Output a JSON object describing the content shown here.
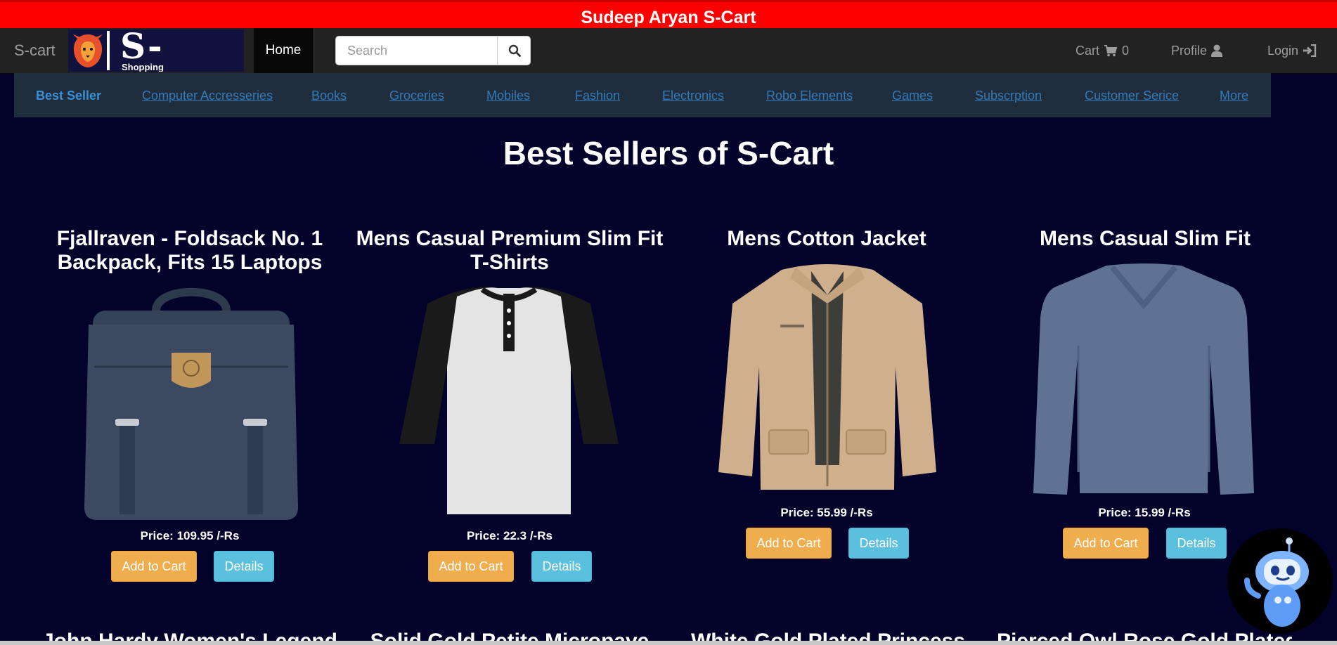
{
  "banner": {
    "title": "Sudeep Aryan S-Cart"
  },
  "navbar": {
    "brand": "S-cart",
    "logo_text": "S-cart",
    "logo_sub": "Shopping",
    "home": "Home",
    "search_placeholder": "Search",
    "cart_label": "Cart",
    "cart_count": "0",
    "profile_label": "Profile",
    "login_label": "Login"
  },
  "categories": [
    "Best Seller",
    "Computer Accresseries",
    "Books",
    "Groceries",
    "Mobiles",
    "Fashion",
    "Electronics",
    "Robo Elements",
    "Games",
    "Subscrption",
    "Customer Serice",
    "More"
  ],
  "page": {
    "heading": "Best Sellers of S-Cart"
  },
  "products": [
    {
      "name": "Fjallraven - Foldsack No. 1 Backpack, Fits 15 Laptops",
      "price": "Price: 109.95 /-Rs",
      "add_label": "Add to Cart",
      "details_label": "Details"
    },
    {
      "name": "Mens Casual Premium Slim Fit T-Shirts",
      "price": "Price: 22.3 /-Rs",
      "add_label": "Add to Cart",
      "details_label": "Details"
    },
    {
      "name": "Mens Cotton Jacket",
      "price": "Price: 55.99 /-Rs",
      "add_label": "Add to Cart",
      "details_label": "Details"
    },
    {
      "name": "Mens Casual Slim Fit",
      "price": "Price: 15.99 /-Rs",
      "add_label": "Add to Cart",
      "details_label": "Details"
    }
  ],
  "next_products": [
    "John Hardy Women's Legends",
    "Solid Gold Petite Micropave",
    "White Gold Plated Princess",
    "Pierced Owl Rose Gold Plated"
  ],
  "colors": {
    "banner": "#ff0000",
    "page_bg": "#02022a",
    "navbar": "#222222",
    "category_bar": "#202d3c",
    "link": "#337ab7",
    "add_button": "#f0ad4e",
    "details_button": "#5bc0de"
  },
  "icons": {
    "search": "search-icon",
    "cart": "cart-icon",
    "profile": "user-icon",
    "login": "sign-in-icon",
    "chatbot": "robot-icon",
    "logo": "lion-logo"
  }
}
